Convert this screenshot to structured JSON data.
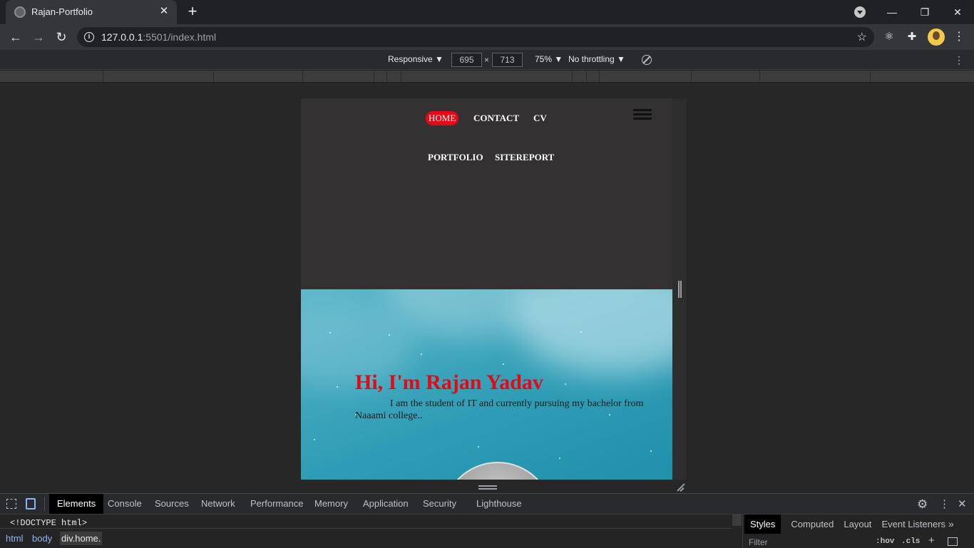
{
  "browser": {
    "tab_title": "Rajan-Portfolio",
    "tab_close": "✕",
    "new_tab": "+",
    "url_host": "127.0.0.1",
    "url_rest": ":5501/index.html",
    "window_minimize": "—",
    "window_restore": "❐",
    "window_close": "✕"
  },
  "device_toolbar": {
    "device": "Responsive ▼",
    "width": "695",
    "times": "×",
    "height": "713",
    "zoom": "75% ▼",
    "throttling": "No throttling ▼"
  },
  "site": {
    "nav": {
      "home": "HOME",
      "contact": "CONTACT",
      "cv": "CV",
      "portfolio": "PORTFOLIO",
      "sitereport": "SITEREPORT"
    },
    "hero": {
      "title": "Hi, I'm Rajan Yadav",
      "description": "I am the student of IT and currently pursuing my bachelor from Naaami college.."
    }
  },
  "devtools": {
    "tabs": [
      "Elements",
      "Console",
      "Sources",
      "Network",
      "Performance",
      "Memory",
      "Application",
      "Security",
      "Lighthouse"
    ],
    "active_tab": "Elements",
    "dom_line": "<!DOCTYPE html>",
    "breadcrumbs": [
      "html",
      "body",
      "div.home."
    ],
    "styles_tabs": [
      "Styles",
      "Computed",
      "Layout",
      "Event Listeners"
    ],
    "styles_more": "»",
    "filter_placeholder": "Filter",
    "hov": ":hov",
    "cls": ".cls",
    "plus": "+"
  },
  "colors": {
    "accent_red": "#e50914",
    "page_bg": "#333131",
    "hero_sky": "#2e9cb5"
  },
  "icons": [
    "globe-favicon",
    "back-arrow-icon",
    "forward-arrow-icon",
    "reload-icon",
    "info-icon",
    "star-icon",
    "react-devtools-icon",
    "puzzle-extensions-icon",
    "profile-avatar",
    "kebab-menu-icon",
    "rotate-icon",
    "hamburger-icon",
    "inspect-icon",
    "device-toggle-icon",
    "gear-icon",
    "close-icon"
  ]
}
